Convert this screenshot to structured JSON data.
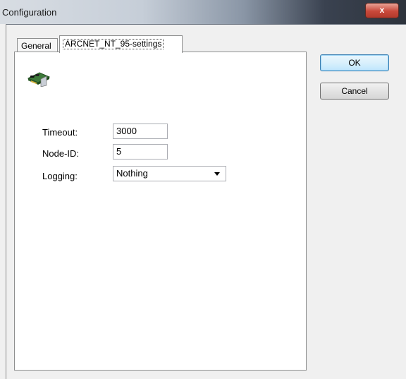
{
  "window": {
    "title": "Configuration",
    "close_label": "x"
  },
  "tabs": [
    {
      "label": "General"
    },
    {
      "label": "ARCNET_NT_95-settings"
    }
  ],
  "form": {
    "timeout_label": "Timeout:",
    "timeout_value": "3000",
    "nodeid_label": "Node-ID:",
    "nodeid_value": "5",
    "logging_label": "Logging:",
    "logging_value": "Nothing"
  },
  "buttons": {
    "ok": "OK",
    "cancel": "Cancel"
  },
  "icons": {
    "device": "network-card-icon",
    "dropdown": "chevron-down-icon",
    "close": "close-icon"
  }
}
